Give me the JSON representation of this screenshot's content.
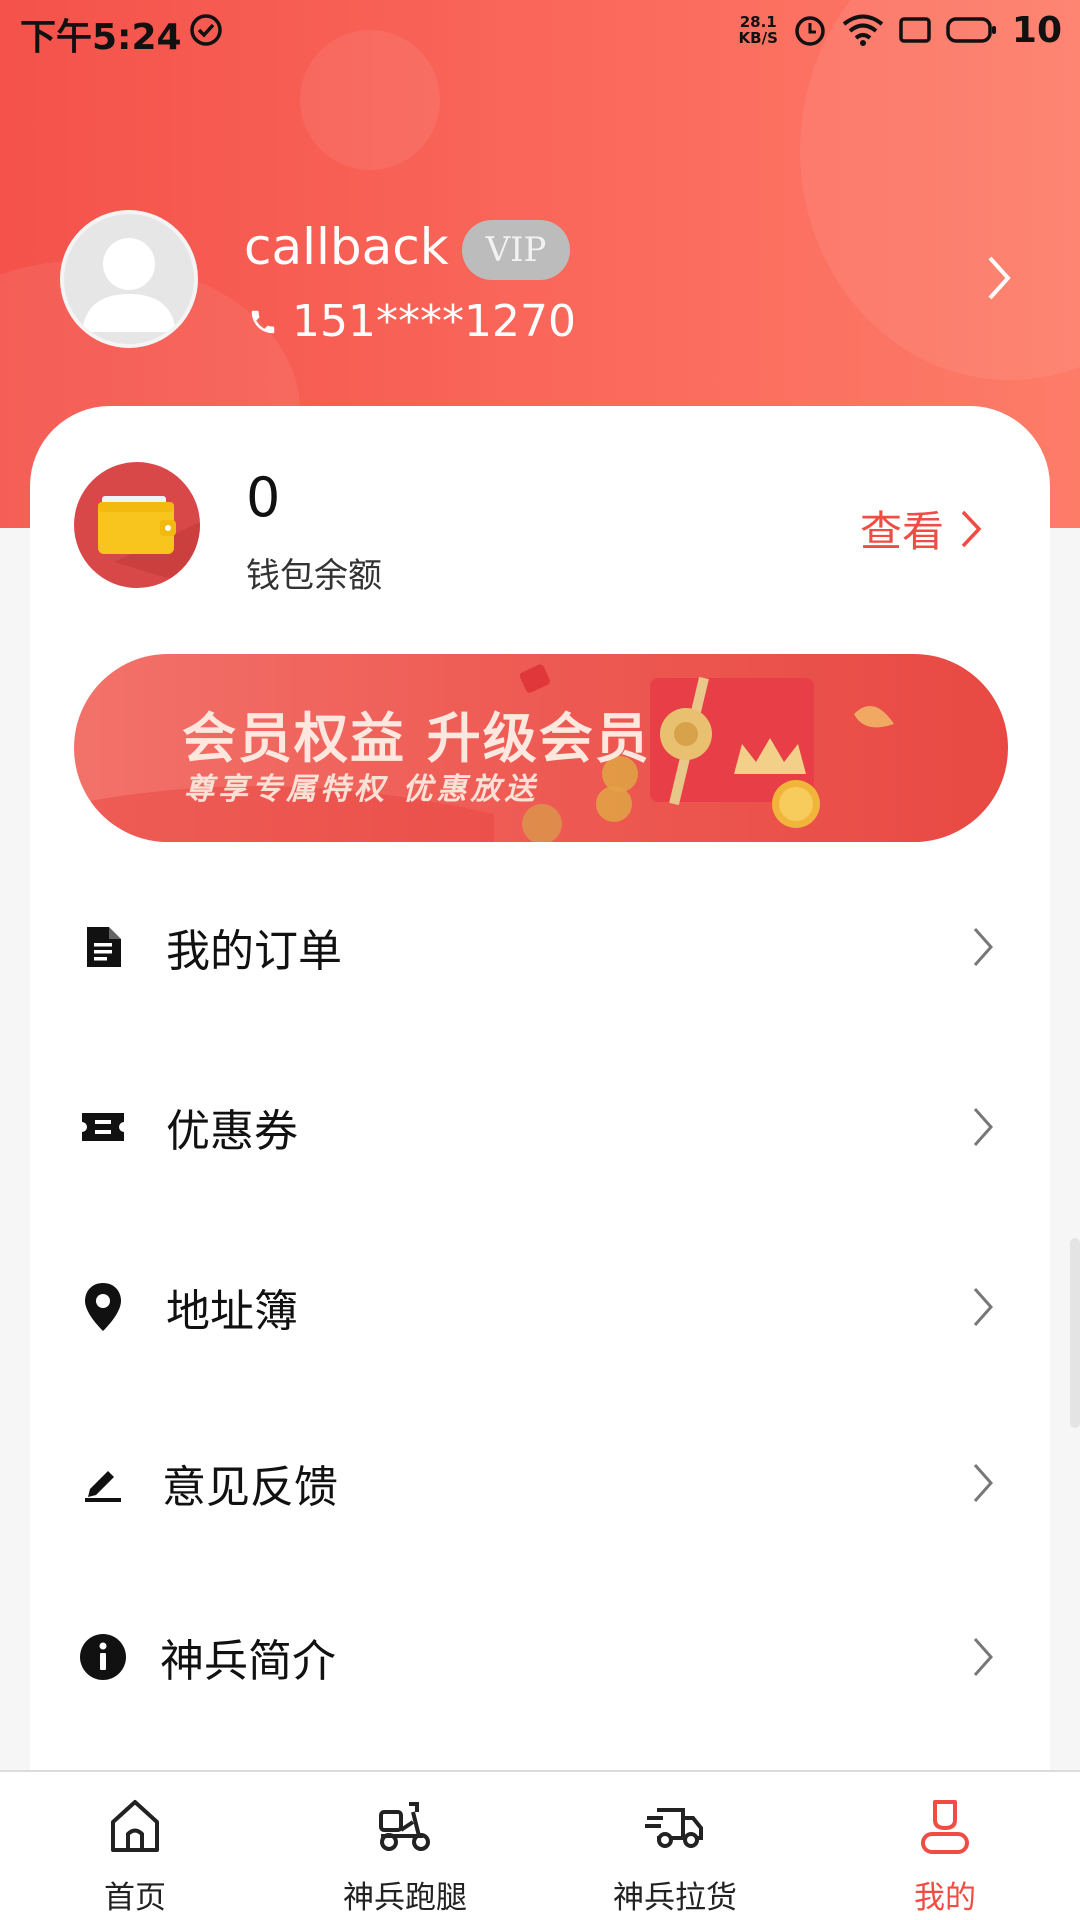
{
  "status_bar": {
    "time": "下午5:24",
    "net_speed_value": "28.1",
    "net_speed_unit": "KB/S",
    "battery": "10"
  },
  "profile": {
    "username": "callback",
    "vip_label": "VIP",
    "phone": "151****1270"
  },
  "wallet": {
    "amount": "0",
    "label": "钱包余额",
    "view_label": "查看"
  },
  "banner": {
    "title": "会员权益 升级会员",
    "subtitle": "尊享专属特权 优惠放送"
  },
  "menu": [
    {
      "label": "我的订单",
      "icon": "document-icon"
    },
    {
      "label": "优惠券",
      "icon": "ticket-icon"
    },
    {
      "label": "地址簿",
      "icon": "location-pin-icon"
    },
    {
      "label": "意见反馈",
      "icon": "pencil-icon"
    },
    {
      "label": "神兵简介",
      "icon": "info-icon"
    }
  ],
  "bottom_nav": [
    {
      "label": "首页",
      "icon": "home-icon",
      "active": false
    },
    {
      "label": "神兵跑腿",
      "icon": "scooter-icon",
      "active": false
    },
    {
      "label": "神兵拉货",
      "icon": "truck-icon",
      "active": false
    },
    {
      "label": "我的",
      "icon": "user-icon",
      "active": true
    }
  ],
  "colors": {
    "accent": "#ef4d44",
    "header_gradient_start": "#f4524a",
    "header_gradient_end": "#fd7c68"
  }
}
